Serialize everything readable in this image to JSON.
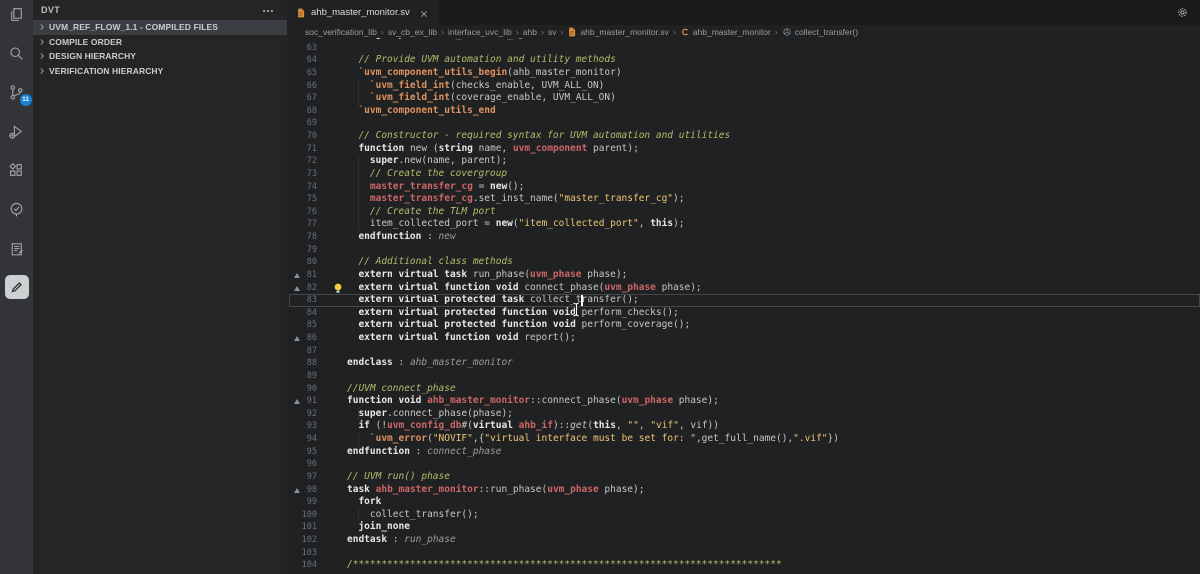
{
  "colors": {
    "editor_bg": "#1f2123",
    "sidebar_bg": "#252526",
    "activity_bg": "#333438",
    "badge_blue": "#1b7fd4",
    "keyword": "#e8e7e4",
    "type_red": "#cc6666",
    "macro_orange": "#de935f",
    "string_yellow": "#f0c674",
    "comment_green": "#b5bd68",
    "plain": "#c5c8c6",
    "line_number": "#6b7178",
    "file_icon_orange": "#d98e3a"
  },
  "activity_bar": {
    "items": [
      {
        "icon": "files-icon"
      },
      {
        "icon": "search-icon"
      },
      {
        "icon": "source-control-icon",
        "badge": "11"
      },
      {
        "icon": "run-debug-icon"
      },
      {
        "icon": "extensions-icon"
      },
      {
        "icon": "verify-circle-check-icon"
      },
      {
        "icon": "build-clipboard-icon"
      },
      {
        "icon": "dvt-pencil-icon",
        "active": true
      }
    ]
  },
  "sidebar": {
    "title": "DVT",
    "items": [
      {
        "label": "UVM_REF_FLOW_1.1 - COMPILED FILES",
        "selected": true
      },
      {
        "label": "COMPILE ORDER"
      },
      {
        "label": "DESIGN HIERARCHY"
      },
      {
        "label": "VERIFICATION HIERARCHY"
      }
    ]
  },
  "editor": {
    "tab": {
      "label": "ahb_master_monitor.sv",
      "icon": "sv-file-icon"
    },
    "breadcrumbs": [
      {
        "label": "soc_verification_lib"
      },
      {
        "label": "sv_cb_ex_lib"
      },
      {
        "label": "interface_uvc_lib"
      },
      {
        "label": "ahb"
      },
      {
        "label": "sv"
      },
      {
        "label": "ahb_master_monitor.sv",
        "icon": "sv-file-icon"
      },
      {
        "label": "ahb_master_monitor",
        "icon": "class-icon"
      },
      {
        "label": "collect_transfer()",
        "icon": "method-icon"
      }
    ],
    "cursor": {
      "line": 83,
      "col": 41
    },
    "code": {
      "lines": [
        {
          "n": 62,
          "t": [
            [
              "  ",
              "pl"
            ],
            [
              "endgroup",
              "kw"
            ],
            [
              " : ",
              "pl"
            ],
            [
              "master_transfer_cg",
              "lb"
            ]
          ]
        },
        {
          "n": 63,
          "g": true,
          "t": []
        },
        {
          "n": 64,
          "t": [
            [
              "  // Provide UVM automation and utility methods",
              "cm"
            ]
          ]
        },
        {
          "n": 65,
          "t": [
            [
              "  ",
              "pl"
            ],
            [
              "`uvm_component_utils_begin",
              "mc"
            ],
            [
              "(ahb_master_monitor)",
              "pl"
            ]
          ]
        },
        {
          "n": 66,
          "g": true,
          "t": [
            [
              "    ",
              "pl"
            ],
            [
              "`uvm_field_int",
              "mc"
            ],
            [
              "(checks_enable, UVM_ALL_ON)",
              "pl"
            ]
          ]
        },
        {
          "n": 67,
          "g": true,
          "t": [
            [
              "    ",
              "pl"
            ],
            [
              "`uvm_field_int",
              "mc"
            ],
            [
              "(coverage_enable, UVM_ALL_ON)",
              "pl"
            ]
          ]
        },
        {
          "n": 68,
          "t": [
            [
              "  ",
              "pl"
            ],
            [
              "`uvm_component_utils_end",
              "mc"
            ]
          ]
        },
        {
          "n": 69,
          "g": true,
          "t": []
        },
        {
          "n": 70,
          "t": [
            [
              "  // Constructor - required syntax for UVM automation and utilities",
              "cm"
            ]
          ]
        },
        {
          "n": 71,
          "t": [
            [
              "  ",
              "pl"
            ],
            [
              "function",
              "kw"
            ],
            [
              " ",
              "pl"
            ],
            [
              "new",
              "pl"
            ],
            [
              " (",
              "pl"
            ],
            [
              "string",
              "kw"
            ],
            [
              " name, ",
              "pl"
            ],
            [
              "uvm_component",
              "ty"
            ],
            [
              " parent);",
              "pl"
            ]
          ]
        },
        {
          "n": 72,
          "g": true,
          "t": [
            [
              "    ",
              "pl"
            ],
            [
              "super",
              "kw"
            ],
            [
              ".new(name, parent);",
              "pl"
            ]
          ]
        },
        {
          "n": 73,
          "g": true,
          "t": [
            [
              "    // Create the covergroup",
              "cm"
            ]
          ]
        },
        {
          "n": 74,
          "g": true,
          "t": [
            [
              "    ",
              "pl"
            ],
            [
              "master_transfer_cg",
              "ty"
            ],
            [
              " = ",
              "pl"
            ],
            [
              "new",
              "kw"
            ],
            [
              "();",
              "pl"
            ]
          ]
        },
        {
          "n": 75,
          "g": true,
          "t": [
            [
              "    ",
              "pl"
            ],
            [
              "master_transfer_cg",
              "ty"
            ],
            [
              ".set_inst_name(",
              "pl"
            ],
            [
              "\"master_transfer_cg\"",
              "st"
            ],
            [
              ");",
              "pl"
            ]
          ]
        },
        {
          "n": 76,
          "g": true,
          "t": [
            [
              "    // Create the TLM port",
              "cm"
            ]
          ]
        },
        {
          "n": 77,
          "g": true,
          "t": [
            [
              "    item_collected_port = ",
              "pl"
            ],
            [
              "new",
              "kw"
            ],
            [
              "(",
              "pl"
            ],
            [
              "\"item_collected_port\"",
              "st"
            ],
            [
              ", ",
              "pl"
            ],
            [
              "this",
              "kw"
            ],
            [
              ");",
              "pl"
            ]
          ]
        },
        {
          "n": 78,
          "t": [
            [
              "  ",
              "pl"
            ],
            [
              "endfunction",
              "kw"
            ],
            [
              " : ",
              "pl"
            ],
            [
              "new",
              "lb"
            ]
          ]
        },
        {
          "n": 79,
          "g": true,
          "t": []
        },
        {
          "n": 80,
          "t": [
            [
              "  // Additional class methods",
              "cm"
            ]
          ]
        },
        {
          "n": 81,
          "m": true,
          "t": [
            [
              "  ",
              "pl"
            ],
            [
              "extern virtual task",
              "kw"
            ],
            [
              " run_phase(",
              "pl"
            ],
            [
              "uvm_phase",
              "ty"
            ],
            [
              " phase);",
              "pl"
            ]
          ]
        },
        {
          "n": 82,
          "m": true,
          "bulb": true,
          "t": [
            [
              "  ",
              "pl"
            ],
            [
              "extern virtual function void",
              "kw"
            ],
            [
              " connect_phase(",
              "pl"
            ],
            [
              "uvm_phase",
              "ty"
            ],
            [
              " phase);",
              "pl"
            ]
          ]
        },
        {
          "n": 83,
          "cur": true,
          "t": [
            [
              "  ",
              "pl"
            ],
            [
              "extern virtual protected task",
              "kw"
            ],
            [
              " collect_transfer();",
              "pl"
            ]
          ]
        },
        {
          "n": 84,
          "t": [
            [
              "  ",
              "pl"
            ],
            [
              "extern virtual protected function void",
              "kw"
            ],
            [
              " perform_checks();",
              "pl"
            ]
          ]
        },
        {
          "n": 85,
          "t": [
            [
              "  ",
              "pl"
            ],
            [
              "extern virtual protected function void",
              "kw"
            ],
            [
              " perform_coverage();",
              "pl"
            ]
          ]
        },
        {
          "n": 86,
          "m": true,
          "t": [
            [
              "  ",
              "pl"
            ],
            [
              "extern virtual function void",
              "kw"
            ],
            [
              " report();",
              "pl"
            ]
          ]
        },
        {
          "n": 87,
          "g": true,
          "t": []
        },
        {
          "n": 88,
          "t": [
            [
              "endclass",
              "kw"
            ],
            [
              " : ",
              "pl"
            ],
            [
              "ahb_master_monitor",
              "lb"
            ]
          ]
        },
        {
          "n": 89,
          "t": []
        },
        {
          "n": 90,
          "t": [
            [
              "//UVM connect_phase",
              "cm"
            ]
          ]
        },
        {
          "n": 91,
          "m": true,
          "t": [
            [
              "function void",
              "kw"
            ],
            [
              " ",
              "pl"
            ],
            [
              "ahb_master_monitor",
              "ty"
            ],
            [
              "::connect_phase(",
              "pl"
            ],
            [
              "uvm_phase",
              "ty"
            ],
            [
              " phase);",
              "pl"
            ]
          ]
        },
        {
          "n": 92,
          "g": true,
          "t": [
            [
              "  ",
              "pl"
            ],
            [
              "super",
              "kw"
            ],
            [
              ".connect_phase(phase);",
              "pl"
            ]
          ]
        },
        {
          "n": 93,
          "t": [
            [
              "  ",
              "pl"
            ],
            [
              "if",
              "kw"
            ],
            [
              " (!",
              "pl"
            ],
            [
              "uvm_config_db",
              "ty"
            ],
            [
              "#(",
              "pl"
            ],
            [
              "virtual",
              "kw"
            ],
            [
              " ",
              "pl"
            ],
            [
              "ahb_if",
              "ty"
            ],
            [
              ")::",
              "pl"
            ],
            [
              "get",
              "it"
            ],
            [
              "(",
              "pl"
            ],
            [
              "this",
              "kw"
            ],
            [
              ", ",
              "pl"
            ],
            [
              "\"\"",
              "st"
            ],
            [
              ", ",
              "pl"
            ],
            [
              "\"vif\"",
              "st"
            ],
            [
              ", vif))",
              "pl"
            ]
          ]
        },
        {
          "n": 94,
          "g": true,
          "t": [
            [
              "    ",
              "pl"
            ],
            [
              "`uvm_error",
              "mc"
            ],
            [
              "(",
              "pl"
            ],
            [
              "\"NOVIF\"",
              "st"
            ],
            [
              ",{",
              "pl"
            ],
            [
              "\"virtual interface must be set for: \"",
              "st"
            ],
            [
              ",get_full_name(),",
              "pl"
            ],
            [
              "\".vif\"",
              "st"
            ],
            [
              "})",
              "pl"
            ]
          ]
        },
        {
          "n": 95,
          "t": [
            [
              "endfunction",
              "kw"
            ],
            [
              " : ",
              "pl"
            ],
            [
              "connect_phase",
              "lb"
            ]
          ]
        },
        {
          "n": 96,
          "t": []
        },
        {
          "n": 97,
          "t": [
            [
              "// UVM run() phase",
              "cm"
            ]
          ]
        },
        {
          "n": 98,
          "m": true,
          "t": [
            [
              "task",
              "kw"
            ],
            [
              " ",
              "pl"
            ],
            [
              "ahb_master_monitor",
              "ty"
            ],
            [
              "::run_phase(",
              "pl"
            ],
            [
              "uvm_phase",
              "ty"
            ],
            [
              " phase);",
              "pl"
            ]
          ]
        },
        {
          "n": 99,
          "t": [
            [
              "  ",
              "pl"
            ],
            [
              "fork",
              "kw"
            ]
          ]
        },
        {
          "n": 100,
          "g": true,
          "t": [
            [
              "    collect_transfer();",
              "pl"
            ]
          ]
        },
        {
          "n": 101,
          "t": [
            [
              "  ",
              "pl"
            ],
            [
              "join_none",
              "kw"
            ]
          ]
        },
        {
          "n": 102,
          "t": [
            [
              "endtask",
              "kw"
            ],
            [
              " : ",
              "pl"
            ],
            [
              "run_phase",
              "lb"
            ]
          ]
        },
        {
          "n": 103,
          "t": []
        },
        {
          "n": 104,
          "t": [
            [
              "/***************************************************************************",
              "cm"
            ]
          ]
        }
      ]
    }
  }
}
